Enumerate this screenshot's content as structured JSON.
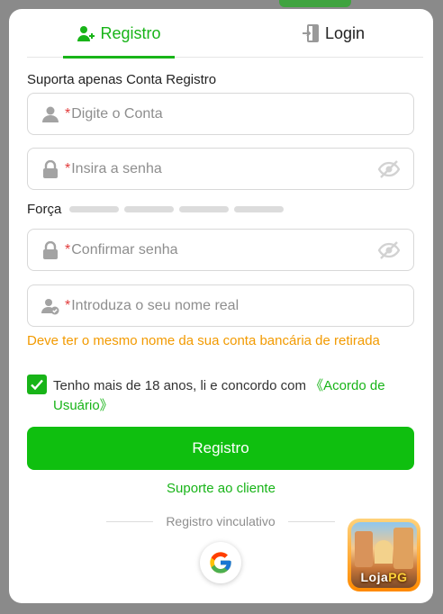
{
  "tabs": {
    "register": "Registro",
    "login": "Login"
  },
  "form": {
    "hint": "Suporta apenas Conta Registro",
    "required_mark": "*",
    "account_placeholder": "Digite o Conta",
    "password_placeholder": "Insira a senha",
    "strength_label": "Força",
    "strength_level": 0,
    "confirm_placeholder": "Confirmar senha",
    "realname_placeholder": "Introduza o seu nome real",
    "realname_warning": "Deve ter o mesmo nome da sua conta bancária de retirada"
  },
  "agreement": {
    "checked": true,
    "text": "Tenho mais de 18 anos, li e concordo com ",
    "link": "《Acordo de Usuário》"
  },
  "actions": {
    "register_button": "Registro",
    "support_link": "Suporte ao cliente",
    "bind_label": "Registro vinculativo"
  },
  "badge": {
    "text_main": "Loja",
    "text_accent": "PG"
  },
  "colors": {
    "accent_green": "#18b418",
    "button_green": "#0fbf0f",
    "warning_orange": "#f29a00",
    "required_red": "#e23c3c"
  },
  "icons": [
    "user-plus-icon",
    "login-door-icon",
    "user-icon",
    "lock-icon",
    "eye-slash-icon",
    "user-verified-icon",
    "check-icon",
    "google-icon"
  ]
}
